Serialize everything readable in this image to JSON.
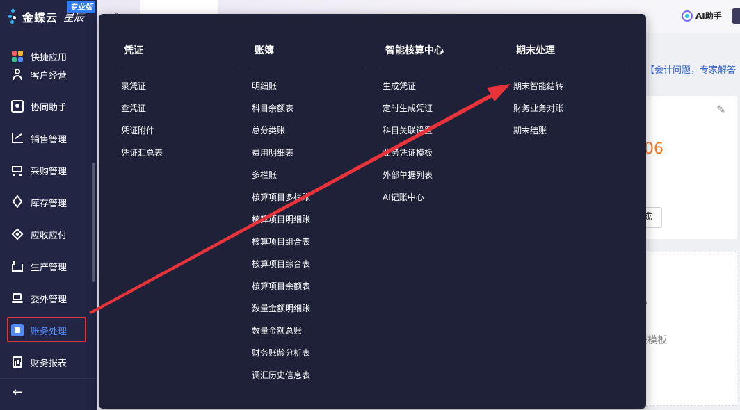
{
  "sidebar": {
    "brand": "金蝶云",
    "brand_sub": "星辰",
    "edition": "专业版",
    "items": [
      {
        "label": "快捷应用",
        "icon": "grid-apps-icon"
      },
      {
        "label": "客户经营",
        "icon": "person-icon"
      },
      {
        "label": "协同助手",
        "icon": "contact-card-icon"
      },
      {
        "label": "销售管理",
        "icon": "trend-chart-icon"
      },
      {
        "label": "采购管理",
        "icon": "cart-icon"
      },
      {
        "label": "库存管理",
        "icon": "cube-icon"
      },
      {
        "label": "应收应付",
        "icon": "diamond-icon"
      },
      {
        "label": "生产管理",
        "icon": "factory-icon"
      },
      {
        "label": "委外管理",
        "icon": "outsource-icon"
      },
      {
        "label": "账务处理",
        "icon": "ledger-icon"
      },
      {
        "label": "财务报表",
        "icon": "report-icon"
      }
    ],
    "active_item": "账务处理",
    "back_icon": "←"
  },
  "topbar": {
    "ai_assistant": "AI助手"
  },
  "background": {
    "notice": "【会计问题，专家解答",
    "card_number": "06",
    "card_button": "成",
    "card2_text": "证模板"
  },
  "menu": {
    "columns": [
      {
        "title": "凭证",
        "items": [
          "录凭证",
          "查凭证",
          "凭证附件",
          "凭证汇总表"
        ]
      },
      {
        "title": "账簿",
        "items": [
          "明细账",
          "科目余额表",
          "总分类账",
          "费用明细表",
          "多栏账",
          "核算项目多栏账",
          "核算项目明细账",
          "核算项目组合表",
          "核算项目综合表",
          "核算项目余额表",
          "数量金额明细账",
          "数量金额总账",
          "财务账龄分析表",
          "调汇历史信息表"
        ]
      },
      {
        "title": "智能核算中心",
        "items": [
          "生成凭证",
          "定时生成凭证",
          "科目关联设置",
          "业务凭证模板",
          "外部单据列表",
          "AI记账中心"
        ]
      },
      {
        "title": "期末处理",
        "items": [
          "期末智能结转",
          "财务业务对账",
          "期末结账"
        ]
      }
    ]
  },
  "colors": {
    "sidebar_bg": "#222544",
    "menu_bg": "#1f2138",
    "accent_blue": "#4f8cff",
    "annotation_red": "#e8333a",
    "highlight_orange": "#f07a26"
  }
}
